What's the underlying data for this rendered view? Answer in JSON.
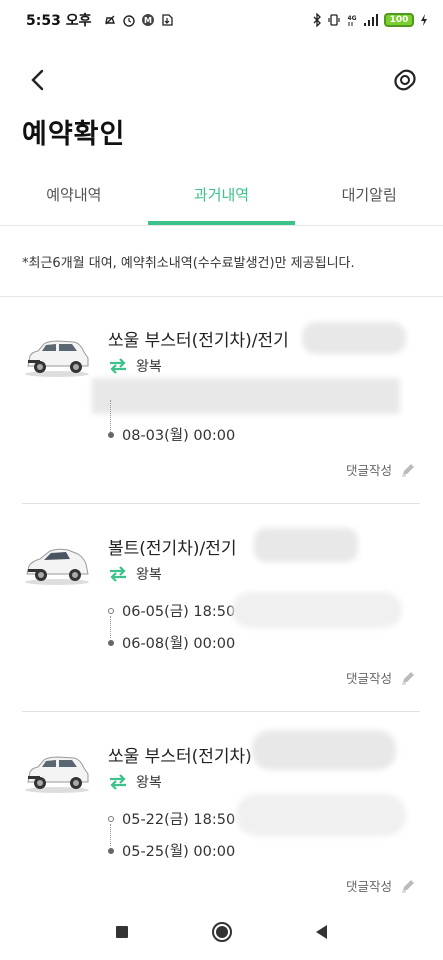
{
  "status_bar": {
    "time": "5:53 오후",
    "battery": "100",
    "icons": [
      "mute-icon",
      "alarm-icon",
      "m-icon",
      "download-icon",
      "bluetooth-icon",
      "vibrate-icon",
      "network-4g-icon",
      "signal-icon",
      "charging-icon"
    ]
  },
  "header": {
    "title": "예약확인",
    "back_icon": "chevron-left-icon",
    "action_icon": "camera-icon"
  },
  "tabs": [
    {
      "label": "예약내역",
      "active": false
    },
    {
      "label": "과거내역",
      "active": true
    },
    {
      "label": "대기알림",
      "active": false
    }
  ],
  "notice": "*최근6개월 대여, 예약취소내역(수수료발생건)만 제공됩니다.",
  "accent_color": "#3cc28a",
  "reservations": [
    {
      "car_name": "쏘울 부스터(전기차)/전기",
      "car_color": "white",
      "trip_type": "왕복",
      "start": "",
      "end": "08-03(월) 00:00",
      "review_label": "댓글작성"
    },
    {
      "car_name": "볼트(전기차)/전기",
      "car_color": "white",
      "trip_type": "왕복",
      "start": "06-05(금) 18:50",
      "end": "06-08(월) 00:00",
      "review_label": "댓글작성"
    },
    {
      "car_name": "쏘울 부스터(전기차)",
      "car_color": "white",
      "trip_type": "왕복",
      "start": "05-22(금) 18:50",
      "end": "05-25(월) 00:00",
      "review_label": "댓글작성"
    }
  ],
  "navbar": {
    "recents_icon": "square-icon",
    "home_icon": "circle-icon",
    "back_icon": "triangle-back-icon"
  }
}
